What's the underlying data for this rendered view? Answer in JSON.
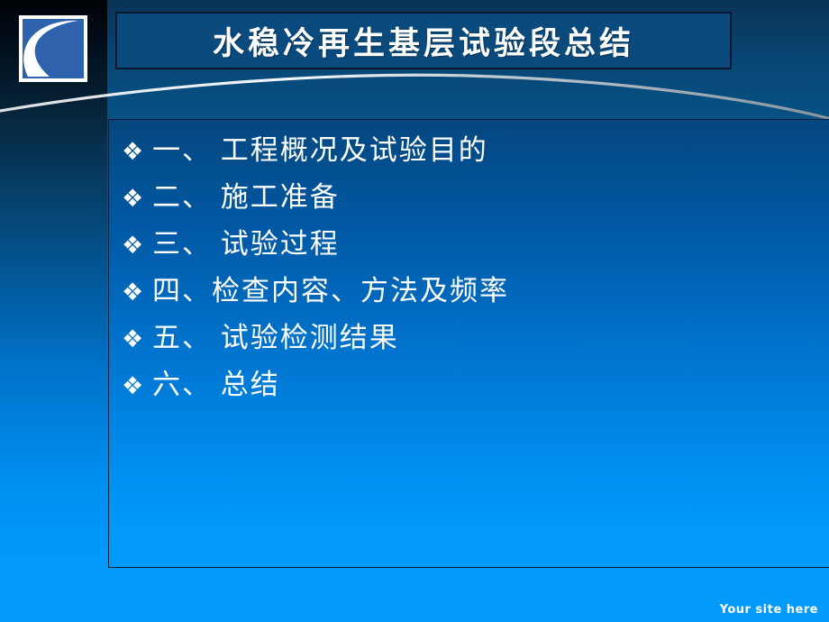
{
  "slide": {
    "title": "水稳冷再生基层试验段总结",
    "footer": "Your site here",
    "logo_alt": "road-logo",
    "colors": {
      "title_box_bg": "#0a4a7d",
      "title_box_border": "#0a1733",
      "content_border": "#0c1e3d",
      "text": "#ffffff",
      "bg_top": "#0b2b4a",
      "bg_bottom": "#039bfb",
      "logo_blue": "#2e62ad",
      "swoosh": "#d8dde2"
    },
    "bullets": [
      {
        "glyph": "❖",
        "label": "一、 工程概况及试验目的"
      },
      {
        "glyph": "❖",
        "label": "二、 施工准备"
      },
      {
        "glyph": "❖",
        "label": "三、 试验过程"
      },
      {
        "glyph": "❖",
        "label": "四、检查内容、方法及频率"
      },
      {
        "glyph": "❖",
        "label": "五、 试验检测结果"
      },
      {
        "glyph": "❖",
        "label": "六、 总结"
      }
    ]
  }
}
